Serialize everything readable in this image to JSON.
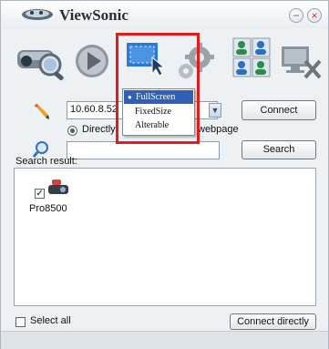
{
  "window": {
    "title": "ViewSonic",
    "minimize_label": "−",
    "close_label": "×"
  },
  "toolbar": {
    "icons": [
      "search-projector-icon",
      "play-icon",
      "display-mode-icon",
      "settings-icon",
      "users-icon",
      "disconnect-icon"
    ]
  },
  "display_menu": {
    "items": [
      {
        "label": "FullScreen",
        "selected": true
      },
      {
        "label": "FixedSize",
        "selected": false
      },
      {
        "label": "Alterable",
        "selected": false
      }
    ]
  },
  "connect_row": {
    "ip_value": "10.60.8.52",
    "connect_label": "Connect",
    "radio_directly_label": "Directly",
    "radio_webpage_label": "webpage"
  },
  "search_row": {
    "search_value": "",
    "search_label": "Search"
  },
  "results": {
    "label": "Search result:",
    "devices": [
      {
        "name": "Pro8500",
        "checked": true
      }
    ]
  },
  "footer": {
    "select_all_label": "Select all",
    "connect_directly_label": "Connect directly"
  },
  "colors": {
    "highlight": "#e21c1c",
    "menu_selected": "#2f5fb6"
  }
}
